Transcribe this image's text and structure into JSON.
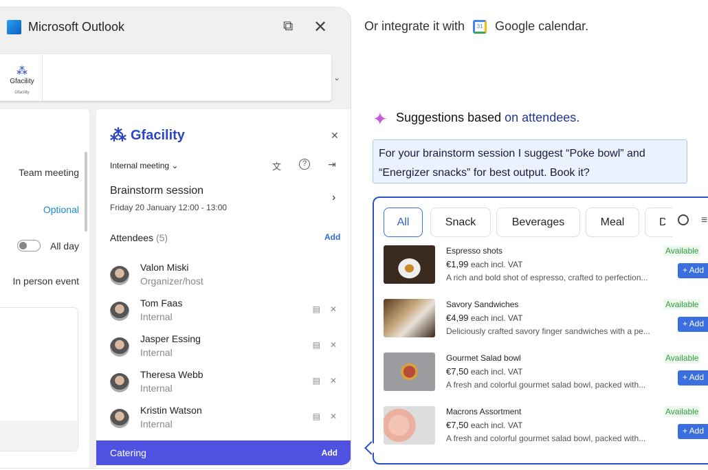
{
  "outlook": {
    "title": "Microsoft Outlook",
    "ribbon_item": "Gfacility",
    "ribbon_group": "Gfacility"
  },
  "form": {
    "subject": "Team meeting",
    "optional": "Optional",
    "allday": "All day",
    "event_type": "In person event"
  },
  "gfacility": {
    "brand": "Gfacility",
    "meeting_type": "Internal meeting",
    "event_title": "Brainstorm session",
    "event_time": "Friday 20 January 12:00 - 13:00",
    "attendees_label": "Attendees",
    "attendees_count": "(5)",
    "add": "Add",
    "attendees": [
      {
        "name": "Valon Miski",
        "role": "Organizer/host"
      },
      {
        "name": "Tom Faas",
        "role": "Internal"
      },
      {
        "name": "Jasper Essing",
        "role": "Internal"
      },
      {
        "name": "Theresa Webb",
        "role": "Internal"
      },
      {
        "name": "Kristin Watson",
        "role": "Internal"
      }
    ],
    "catering_label": "Catering",
    "catering_add": "Add",
    "accent": "#4f52e0"
  },
  "integrate": {
    "prefix": "Or integrate it with",
    "calendar_day": "31",
    "name": "Google calendar."
  },
  "suggestions": {
    "heading": "Suggestions based",
    "heading_on": "on attendees.",
    "message": "For your brainstorm session I suggest “Poke bowl” and “Energizer snacks” for best output. Book it?"
  },
  "catalog": {
    "filters": [
      "All",
      "Snack",
      "Beverages",
      "Meal",
      "D"
    ],
    "active_filter": "All",
    "items": [
      {
        "name": "Espresso shots",
        "price": "€1,99",
        "unit": "each incl. VAT",
        "desc": "A rich and bold shot of espresso, crafted to perfection...",
        "status": "Available",
        "add": "+ Add"
      },
      {
        "name": "Savory Sandwiches",
        "price": "€4,99",
        "unit": "each incl. VAT",
        "desc": "Deliciously crafted savory finger sandwiches with a pe...",
        "status": "Available",
        "add": "+ Add"
      },
      {
        "name": "Gourmet Salad bowl",
        "price": "€7,50",
        "unit": "each incl. VAT",
        "desc": "A fresh and colorful gourmet salad bowl, packed with...",
        "status": "Available",
        "add": "+ Add"
      },
      {
        "name": "Macrons Assortment",
        "price": "€7,50",
        "unit": "each incl. VAT",
        "desc": "A fresh and colorful gourmet salad bowl, packed with...",
        "status": "Available",
        "add": "+ Add"
      }
    ]
  }
}
